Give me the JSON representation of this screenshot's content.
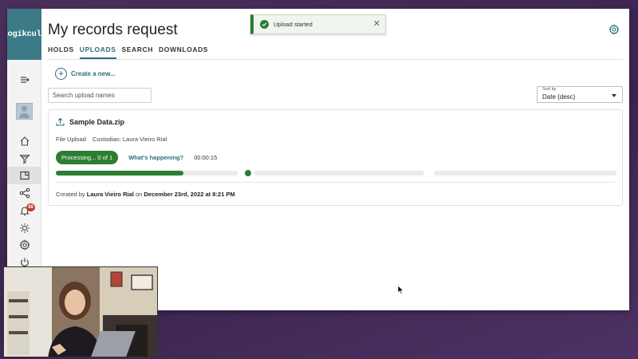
{
  "brand": {
    "logo_text": "logikcull"
  },
  "header": {
    "title": "My records request"
  },
  "tabs": [
    {
      "label": "HOLDS",
      "active": false
    },
    {
      "label": "UPLOADS",
      "active": true
    },
    {
      "label": "SEARCH",
      "active": false
    },
    {
      "label": "DOWNLOADS",
      "active": false
    }
  ],
  "toolbar": {
    "create_label": "Create a new...",
    "search_placeholder": "Search upload names",
    "sort_label": "Sort by",
    "sort_value": "Date (desc)"
  },
  "sidebar": {
    "notification_count": "88",
    "icons": [
      "collapse-icon",
      "avatar",
      "home-icon",
      "filter-icon",
      "uploads-icon",
      "share-icon",
      "bell-icon",
      "sun-icon",
      "gear-icon",
      "power-icon"
    ]
  },
  "upload": {
    "file_name": "Sample Data.zip",
    "type": "File Upload",
    "custodian": "Custodian: Laura Vieiro Rial",
    "status": "Processing... 0 of 1",
    "help_link": "What's happening?",
    "elapsed": "00:00:15",
    "stage_progress": [
      0.7,
      0,
      0
    ],
    "created_prefix": "Created by",
    "created_by": "Laura Vieiro Rial",
    "created_on_word": "on",
    "created_date": "December 23rd, 2022 at 8:21 PM"
  },
  "toast": {
    "message": "Upload started"
  },
  "colors": {
    "accent": "#2e6c7a",
    "success": "#2e7d32",
    "logo_bg": "#3b7a86",
    "alert": "#c0392b"
  }
}
